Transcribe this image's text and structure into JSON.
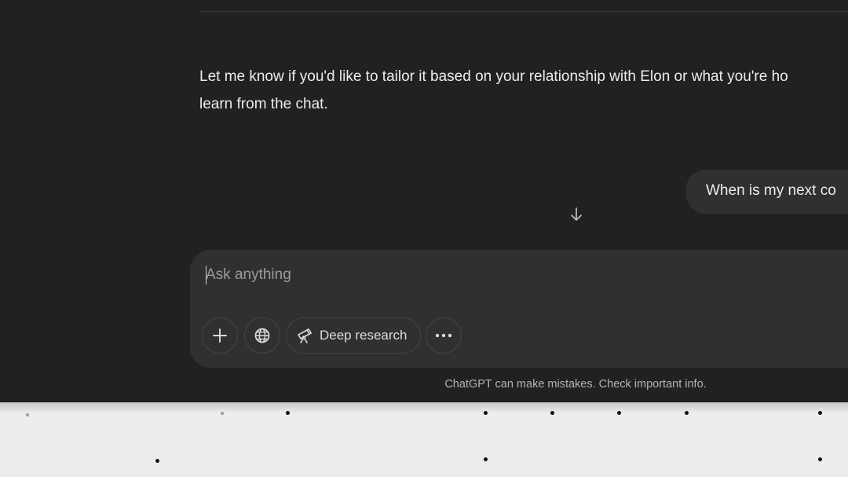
{
  "chat": {
    "assistant_line_1": "Let me know if you'd like to tailor it based on your relationship with Elon or what you're ho",
    "assistant_line_2": "learn from the chat.",
    "user_message": "When is my next co"
  },
  "composer": {
    "placeholder": "Ask anything",
    "deep_research_label": "Deep research"
  },
  "footer": {
    "disclaimer": "ChatGPT can make mistakes. Check important info."
  },
  "icons": {
    "scroll": "arrow-down-icon",
    "add": "plus-icon",
    "search": "globe-icon",
    "research": "telescope-icon",
    "more": "ellipsis-icon"
  },
  "colors": {
    "background": "#212121",
    "composer": "#303030",
    "text": "#ececec"
  }
}
